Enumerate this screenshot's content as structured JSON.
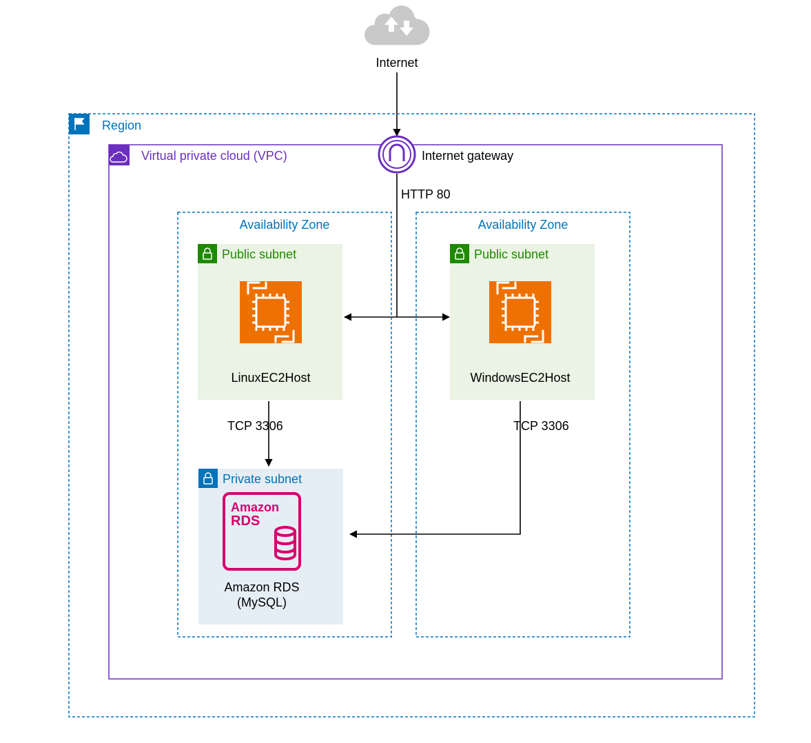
{
  "internet": {
    "label": "Internet"
  },
  "region": {
    "label": "Region",
    "color": "#0073bb"
  },
  "vpc": {
    "label": "Virtual private cloud (VPC)",
    "color": "#6b2fbf"
  },
  "igw": {
    "label": "Internet gateway",
    "color": "#6b2fbf"
  },
  "az_left": {
    "label": "Availability Zone",
    "color": "#0073bb"
  },
  "az_right": {
    "label": "Availability Zone",
    "color": "#0073bb"
  },
  "public_subnet_left": {
    "label": "Public subnet",
    "color": "#1e8a00"
  },
  "public_subnet_right": {
    "label": "Public subnet",
    "color": "#1e8a00"
  },
  "private_subnet": {
    "label": "Private subnet",
    "color": "#0073bb"
  },
  "ec2_left": {
    "label": "LinuxEC2Host",
    "color": "#ed7100"
  },
  "ec2_right": {
    "label": "WindowsEC2Host",
    "color": "#ed7100"
  },
  "rds": {
    "label_top": "Amazon RDS",
    "label_bottom": "(MySQL)",
    "logo_top": "Amazon",
    "logo_bottom": "RDS",
    "color": "#d6006c"
  },
  "conn_http": {
    "label": "HTTP 80"
  },
  "conn_tcp_left": {
    "label": "TCP 3306"
  },
  "conn_tcp_right": {
    "label": "TCP 3306"
  }
}
